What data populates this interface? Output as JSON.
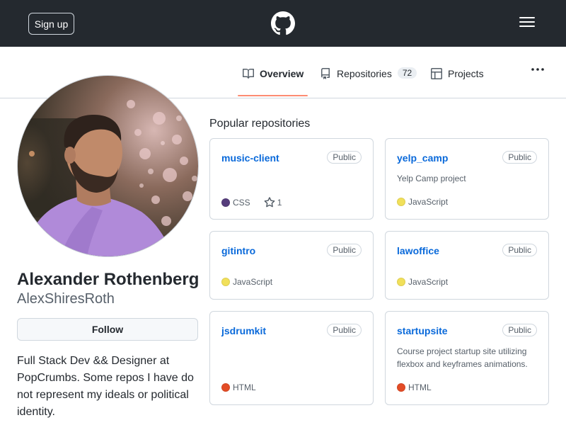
{
  "header": {
    "signup_label": "Sign up",
    "logo_icon": "github-mark-icon",
    "menu_icon": "hamburger-icon"
  },
  "tabs": {
    "overview_label": "Overview",
    "repositories_label": "Repositories",
    "repositories_count": "72",
    "projects_label": "Projects",
    "more_icon": "kebab-icon",
    "active_color": "#fd8c73"
  },
  "profile": {
    "name": "Alexander Rothenberg",
    "login": "AlexShiresRoth",
    "follow_label": "Follow",
    "bio": "Full Stack Dev && Designer at PopCrumbs. Some repos I have do not represent my ideals or political identity."
  },
  "popular": {
    "heading": "Popular repositories",
    "repos": [
      {
        "name": "music-client",
        "visibility": "Public",
        "description": "",
        "language": "CSS",
        "language_color": "#563d7c",
        "stars": "1"
      },
      {
        "name": "yelp_camp",
        "visibility": "Public",
        "description": "Yelp Camp project",
        "language": "JavaScript",
        "language_color": "#f1e05a",
        "stars": ""
      },
      {
        "name": "gitintro",
        "visibility": "Public",
        "description": "",
        "language": "JavaScript",
        "language_color": "#f1e05a",
        "stars": ""
      },
      {
        "name": "lawoffice",
        "visibility": "Public",
        "description": "",
        "language": "JavaScript",
        "language_color": "#f1e05a",
        "stars": ""
      },
      {
        "name": "jsdrumkit",
        "visibility": "Public",
        "description": "",
        "language": "HTML",
        "language_color": "#e34c26",
        "stars": ""
      },
      {
        "name": "startupsite",
        "visibility": "Public",
        "description": "Course project startup site utilizing flexbox and keyframes animations.",
        "language": "HTML",
        "language_color": "#e34c26",
        "stars": ""
      }
    ]
  },
  "colors": {
    "header_bg": "#24292f",
    "link": "#0969da",
    "border": "#d0d7de",
    "muted": "#57606a"
  }
}
